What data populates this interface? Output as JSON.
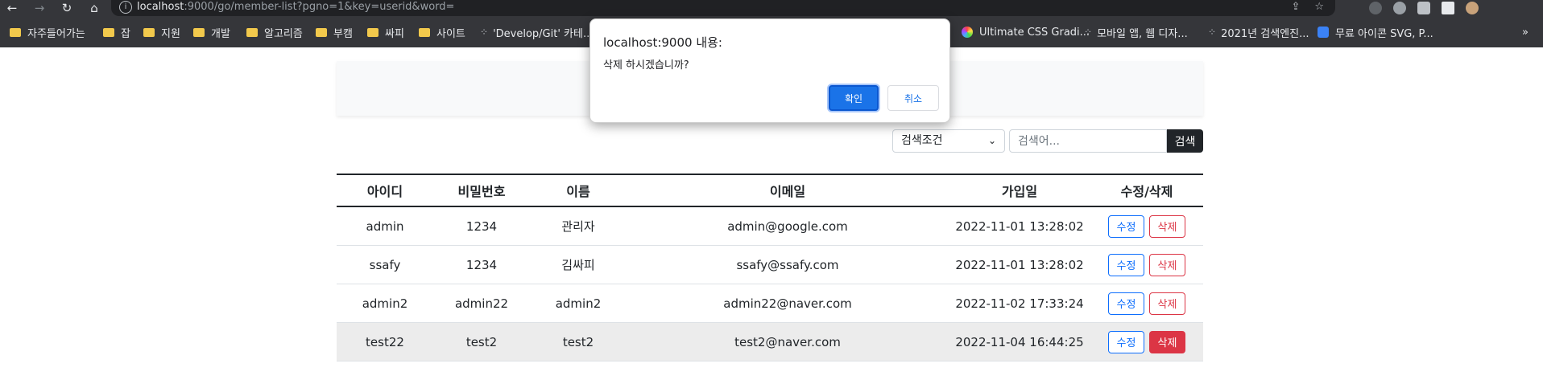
{
  "browser": {
    "url_host": "localhost",
    "url_rest": ":9000/go/member-list?pgno=1&key=userid&word=",
    "bookmarks": [
      "자주들어가는",
      "잡",
      "지원",
      "개발",
      "알고리즘",
      "부캠",
      "싸피",
      "사이트",
      "'Develop/Git' 카테...",
      "Ultimate CSS Gradi...",
      "모바일 앱, 웹 디자...",
      "2021년 검색엔진...",
      "무료 아이콘 SVG, P..."
    ],
    "more": "»"
  },
  "search": {
    "select_value": "검색조건",
    "placeholder": "검색어...",
    "button": "검색"
  },
  "table": {
    "headers": [
      "아이디",
      "비밀번호",
      "이름",
      "이메일",
      "가입일",
      "수정/삭제"
    ],
    "edit_label": "수정",
    "delete_label": "삭제",
    "rows": [
      {
        "id": "admin",
        "password": "1234",
        "name": "관리자",
        "email": "admin@google.com",
        "joined": "2022-11-01 13:28:02"
      },
      {
        "id": "ssafy",
        "password": "1234",
        "name": "김싸피",
        "email": "ssafy@ssafy.com",
        "joined": "2022-11-01 13:28:02"
      },
      {
        "id": "admin2",
        "password": "admin22",
        "name": "admin2",
        "email": "admin22@naver.com",
        "joined": "2022-11-02 17:33:24"
      },
      {
        "id": "test22",
        "password": "test2",
        "name": "test2",
        "email": "test2@naver.com",
        "joined": "2022-11-04 16:44:25"
      }
    ]
  },
  "dialog": {
    "title": "localhost:9000 내용:",
    "message": "삭제 하시겠습니까?",
    "ok": "확인",
    "cancel": "취소"
  },
  "colors": {
    "primary": "#0d6efd",
    "danger": "#dc3545",
    "dark": "#212529",
    "dialog_ok": "#1a73e8"
  }
}
